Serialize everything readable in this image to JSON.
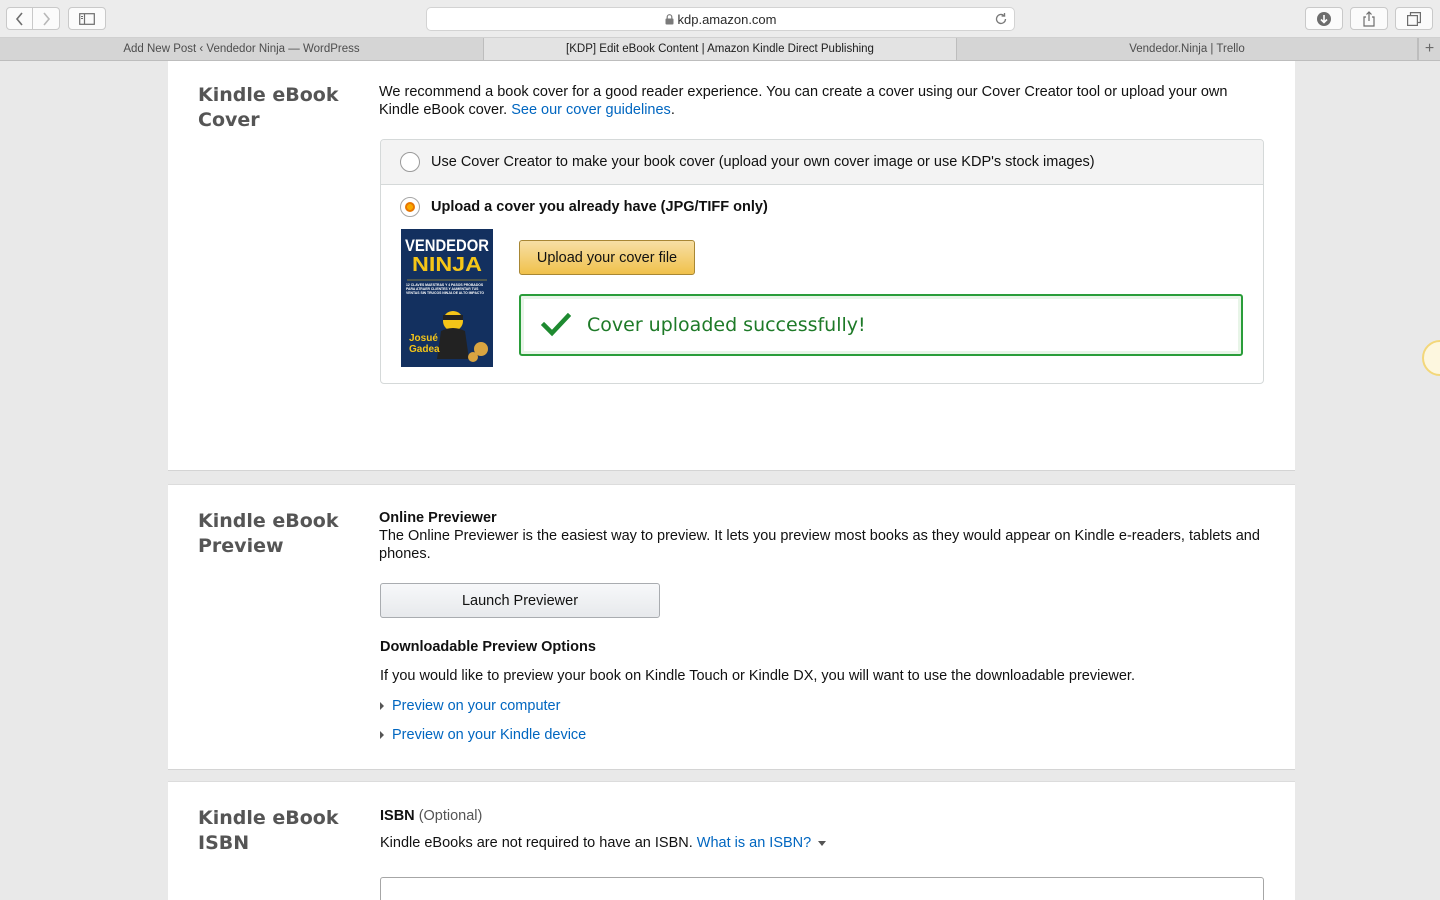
{
  "browser": {
    "url": "kdp.amazon.com",
    "tabs": [
      {
        "label": "Add New Post ‹ Vendedor Ninja — WordPress"
      },
      {
        "label": "[KDP] Edit eBook Content | Amazon Kindle Direct Publishing"
      },
      {
        "label": "Vendedor.Ninja | Trello"
      }
    ],
    "new_tab_symbol": "+"
  },
  "cover": {
    "title": "Kindle eBook Cover",
    "intro": "We recommend a book cover for a good reader experience. You can create a cover using our Cover Creator tool or upload your own Kindle eBook cover.",
    "guidelines_link": "See our cover guidelines",
    "period": ".",
    "option_creator": "Use Cover Creator to make your book cover (upload your own cover image or use KDP's stock images)",
    "option_upload": "Upload a cover you already have (JPG/TIFF only)",
    "upload_button": "Upload your cover file",
    "success_message": "Cover uploaded successfully!",
    "thumbnail": {
      "line1": "VENDEDOR",
      "line2": "NINJA",
      "subtitle": "12 CLAVES MAESTRAS Y 4 PASOS PROBADOS PARA ATRAER CLIENTES Y AUMENTAR TUS VENTAS SIN TRUCOS NINJA DE ALTO IMPACTO",
      "author1": "Josué",
      "author2": "Gadea"
    }
  },
  "preview": {
    "title": "Kindle eBook Preview",
    "online_heading": "Online Previewer",
    "online_text": "The Online Previewer is the easiest way to preview. It lets you preview most books as they would appear on Kindle e-readers, tablets and phones.",
    "launch_button": "Launch Previewer",
    "downloadable_heading": "Downloadable Preview Options",
    "downloadable_text": "If you would like to preview your book on Kindle Touch or Kindle DX, you will want to use the downloadable previewer.",
    "link_computer": "Preview on your computer",
    "link_device": "Preview on your Kindle device"
  },
  "isbn": {
    "title": "Kindle eBook ISBN",
    "label": "ISBN",
    "optional": "(Optional)",
    "text": "Kindle eBooks are not required to have an ISBN.",
    "link": "What is an ISBN?"
  },
  "colors": {
    "link": "#0066c0",
    "upload_button": "#f0c14b",
    "success": "#1e7a28",
    "cover_bg": "#13305f",
    "cover_yellow": "#f5c518"
  }
}
